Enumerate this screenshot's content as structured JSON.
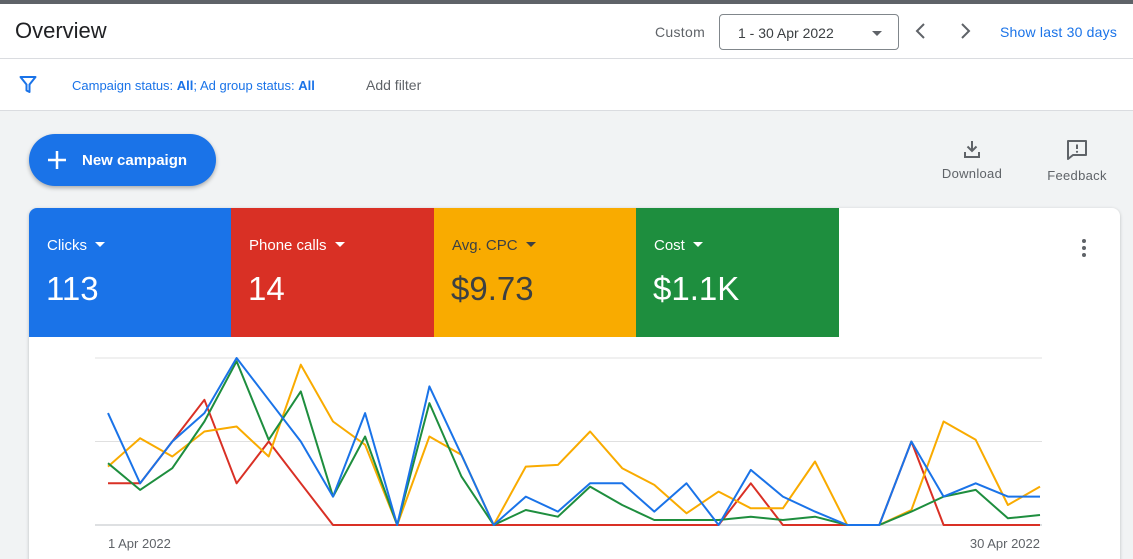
{
  "header": {
    "title": "Overview",
    "custom_label": "Custom",
    "date_range": "1 - 30 Apr 2022",
    "show_last": "Show last 30 days"
  },
  "filter": {
    "campaign_status_label": "Campaign status:",
    "campaign_status_value": "All",
    "separator": ";",
    "ad_group_status_label": "Ad group status:",
    "ad_group_status_value": "All",
    "add_filter": "Add filter"
  },
  "actions": {
    "new_campaign": "New campaign",
    "download": "Download",
    "feedback": "Feedback"
  },
  "metrics": [
    {
      "name": "Clicks",
      "value": "113",
      "color": "#1a73e8"
    },
    {
      "name": "Phone calls",
      "value": "14",
      "color": "#d93025"
    },
    {
      "name": "Avg. CPC",
      "value": "$9.73",
      "color": "#f9ab00"
    },
    {
      "name": "Cost",
      "value": "$1.1K",
      "color": "#1e8e3e"
    }
  ],
  "chart_data": {
    "type": "line",
    "x_start_label": "1 Apr 2022",
    "x_end_label": "30 Apr 2022",
    "x": [
      1,
      2,
      3,
      4,
      5,
      6,
      7,
      8,
      9,
      10,
      11,
      12,
      13,
      14,
      15,
      16,
      17,
      18,
      19,
      20,
      21,
      22,
      23,
      24,
      25,
      26,
      27,
      28,
      29,
      30
    ],
    "ylim": [
      0,
      1
    ],
    "grid": true,
    "series": [
      {
        "metric": "Clicks",
        "color": "#1a73e8",
        "values": [
          0.67,
          0.25,
          0.5,
          0.67,
          1.0,
          0.75,
          0.5,
          0.17,
          0.67,
          0.0,
          0.83,
          0.42,
          0.0,
          0.17,
          0.08,
          0.25,
          0.25,
          0.08,
          0.25,
          0.0,
          0.33,
          0.17,
          0.08,
          0.0,
          0.0,
          0.5,
          0.17,
          0.25,
          0.17,
          0.17
        ]
      },
      {
        "metric": "Phone calls",
        "color": "#d93025",
        "values": [
          0.25,
          0.25,
          0.5,
          0.75,
          0.25,
          0.5,
          0.25,
          0.0,
          0.0,
          0.0,
          0.0,
          0.0,
          0.0,
          0.0,
          0.0,
          0.0,
          0.0,
          0.0,
          0.0,
          0.0,
          0.25,
          0.0,
          0.0,
          0.0,
          0.0,
          0.5,
          0.0,
          0.0,
          0.0,
          0.0
        ]
      },
      {
        "metric": "Avg. CPC",
        "color": "#f9ab00",
        "values": [
          0.35,
          0.52,
          0.41,
          0.56,
          0.59,
          0.41,
          0.96,
          0.62,
          0.48,
          0.0,
          0.53,
          0.42,
          0.0,
          0.35,
          0.36,
          0.56,
          0.34,
          0.24,
          0.07,
          0.2,
          0.1,
          0.1,
          0.38,
          0.0,
          0.0,
          0.09,
          0.62,
          0.51,
          0.12,
          0.23
        ]
      },
      {
        "metric": "Cost",
        "color": "#1e8e3e",
        "values": [
          0.37,
          0.21,
          0.34,
          0.62,
          0.98,
          0.51,
          0.8,
          0.17,
          0.53,
          0.0,
          0.73,
          0.29,
          0.0,
          0.09,
          0.05,
          0.23,
          0.12,
          0.03,
          0.03,
          0.03,
          0.05,
          0.03,
          0.05,
          0.0,
          0.0,
          0.08,
          0.17,
          0.21,
          0.04,
          0.06
        ]
      }
    ]
  }
}
